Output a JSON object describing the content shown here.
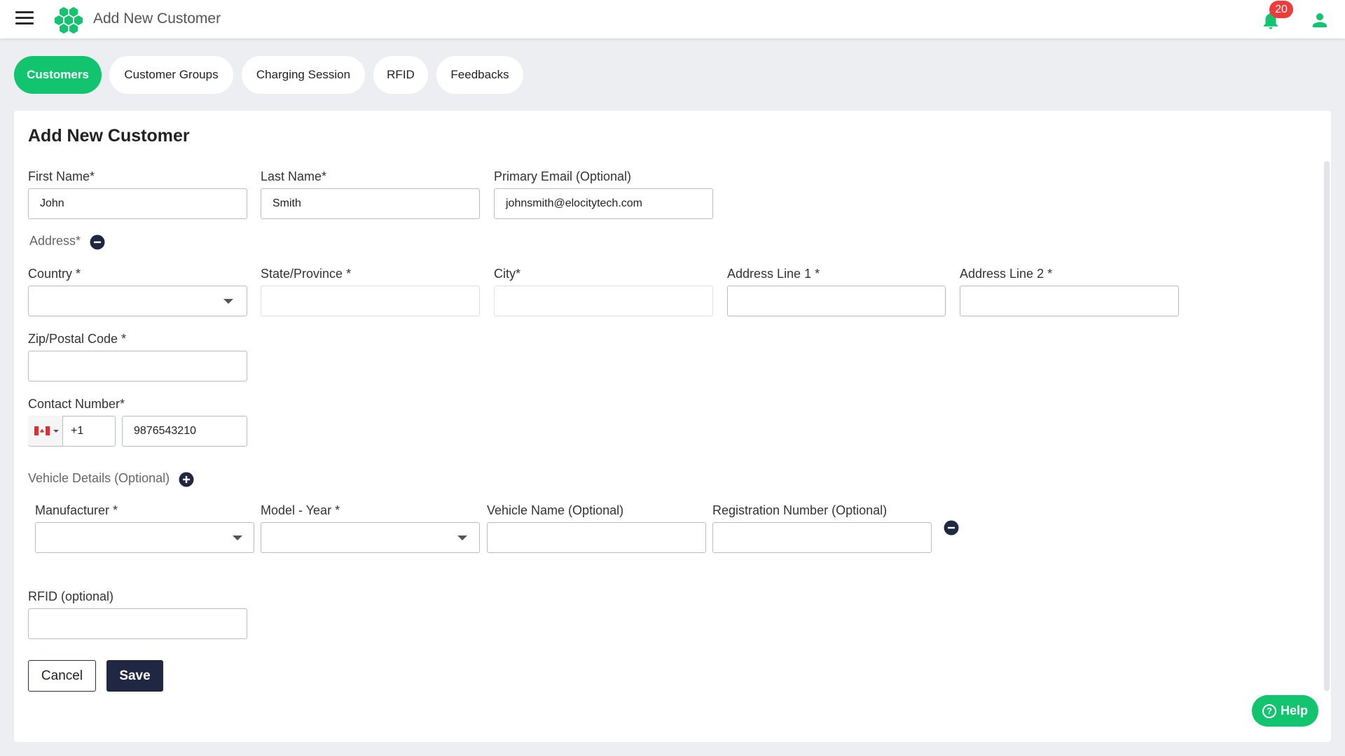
{
  "header": {
    "title": "Add New Customer",
    "notification_count": "20",
    "accent_color": "#12c46e",
    "badge_color": "#ee3b3b"
  },
  "tabs": [
    {
      "label": "Customers",
      "active": true
    },
    {
      "label": "Customer Groups",
      "active": false
    },
    {
      "label": "Charging Session",
      "active": false
    },
    {
      "label": "RFID",
      "active": false
    },
    {
      "label": "Feedbacks",
      "active": false
    }
  ],
  "form": {
    "title": "Add New Customer",
    "first_name": {
      "label": "First Name*",
      "value": "John"
    },
    "last_name": {
      "label": "Last Name*",
      "value": "Smith"
    },
    "primary_email": {
      "label": "Primary Email (Optional)",
      "value": "johnsmith@elocitytech.com"
    },
    "address_section": "Address*",
    "country": {
      "label": "Country *",
      "value": ""
    },
    "state": {
      "label": "State/Province *",
      "value": ""
    },
    "city": {
      "label": "City*",
      "value": ""
    },
    "address1": {
      "label": "Address Line 1 *",
      "value": ""
    },
    "address2": {
      "label": "Address Line 2 *",
      "value": ""
    },
    "zip": {
      "label": "Zip/Postal Code *",
      "value": ""
    },
    "contact": {
      "label": "Contact Number*",
      "country_code": "+1",
      "value": "9876543210",
      "flag": "canada-flag-icon"
    },
    "vehicle_section": "Vehicle Details (Optional)",
    "manufacturer": {
      "label": "Manufacturer *",
      "value": ""
    },
    "model_year": {
      "label": "Model - Year *",
      "value": ""
    },
    "vehicle_name": {
      "label": "Vehicle Name (Optional)",
      "value": ""
    },
    "registration": {
      "label": "Registration Number (Optional)",
      "value": ""
    },
    "rfid": {
      "label": "RFID (optional)",
      "value": ""
    },
    "cancel_label": "Cancel",
    "save_label": "Save"
  },
  "help_label": "Help"
}
